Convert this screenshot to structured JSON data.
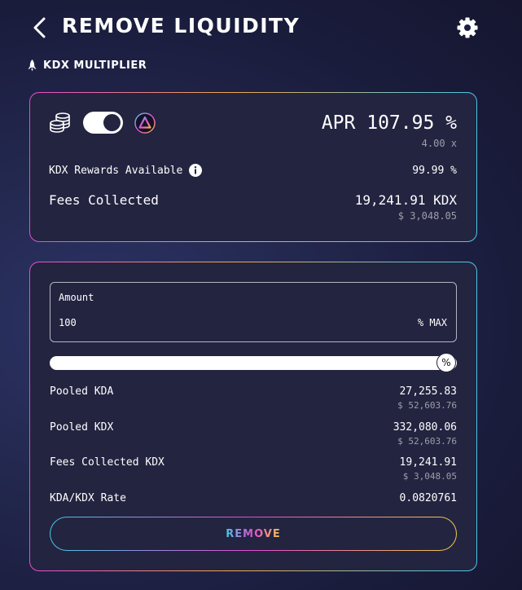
{
  "header": {
    "title": "REMOVE LIQUIDITY"
  },
  "multiplier": {
    "label": "KDX MULTIPLIER"
  },
  "rewards_card": {
    "toggle_on": true,
    "apr_label": "APR 107.95 %",
    "multiplier_value": "4.00 x",
    "rewards_label": "KDX Rewards Available",
    "rewards_value": "99.99 %",
    "fees_label": "Fees Collected",
    "fees_value": "19,241.91 KDX",
    "fees_usd": "$ 3,048.05"
  },
  "remove_card": {
    "amount_label": "Amount",
    "amount_value": "100",
    "amount_suffix": "% MAX",
    "slider_percent": 100,
    "slider_knob_label": "%",
    "rows": [
      {
        "label": "Pooled KDA",
        "value": "27,255.83",
        "sub": "$ 52,603.76"
      },
      {
        "label": "Pooled KDX",
        "value": "332,080.06",
        "sub": "$ 52,603.76"
      },
      {
        "label": "Fees Collected KDX",
        "value": "19,241.91",
        "sub": "$ 3,048.05"
      },
      {
        "label": "KDA/KDX Rate",
        "value": "0.0820761"
      }
    ],
    "remove_label": "REMOVE"
  },
  "icons": {
    "back": "chevron-left-icon",
    "settings": "gear-icon",
    "rocket": "rocket-icon",
    "coins": "coin-stack-icon",
    "token": "token-logo-icon",
    "info": "info-icon"
  }
}
